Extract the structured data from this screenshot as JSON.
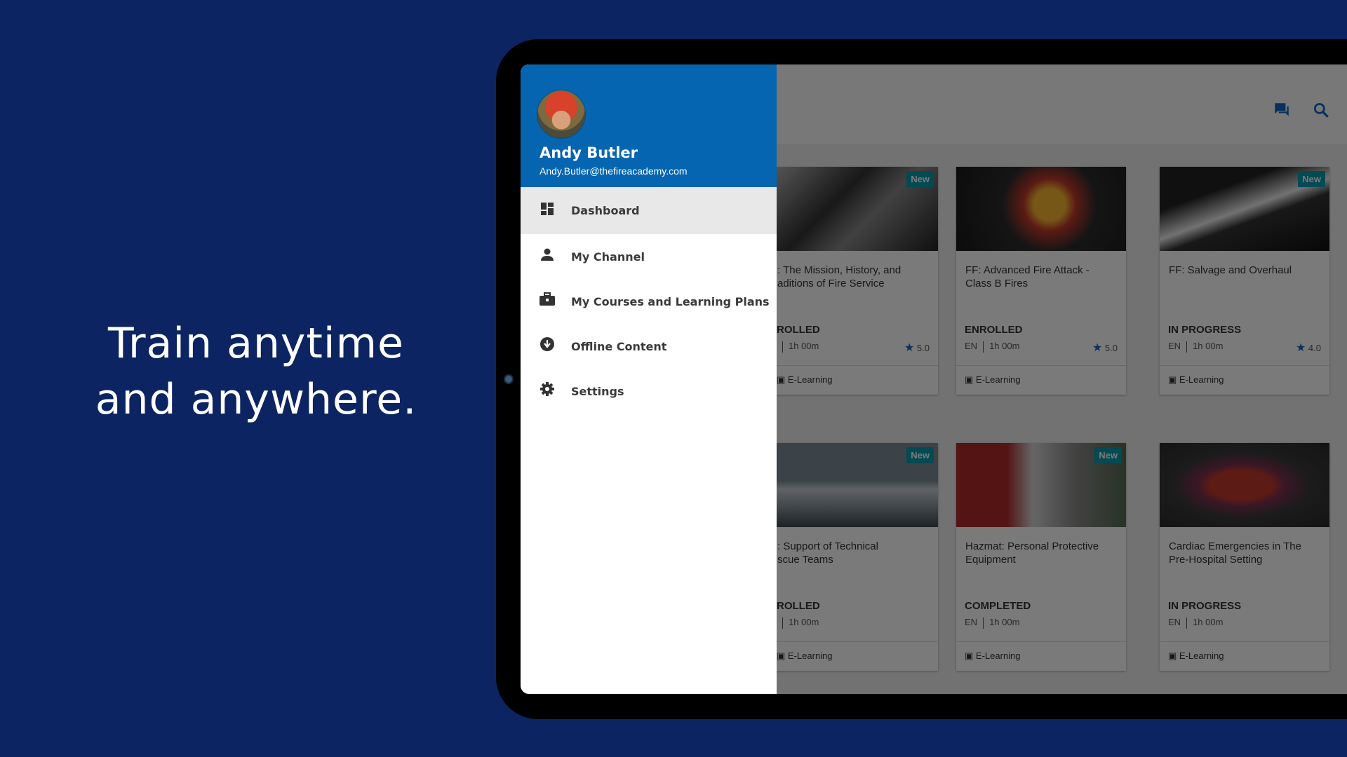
{
  "promo": {
    "line1": "Train anytime",
    "line2": "and anywhere."
  },
  "colors": {
    "background": "#0c2461",
    "drawer_header": "#0565b0",
    "accent": "#1565c0",
    "badge": "#0a9cad"
  },
  "topbar": {
    "icons": [
      "chat-icon",
      "search-icon"
    ]
  },
  "user": {
    "name": "Andy Butler",
    "email": "Andy.Butler@thefireacademy.com"
  },
  "menu": [
    {
      "label": "Dashboard",
      "icon": "dashboard-icon",
      "active": true
    },
    {
      "label": "My Channel",
      "icon": "person-icon"
    },
    {
      "label": "My Courses and Learning Plans",
      "icon": "briefcase-icon"
    },
    {
      "label": "Offline Content",
      "icon": "download-icon"
    },
    {
      "label": "Settings",
      "icon": "gear-icon"
    }
  ],
  "cards": [
    {
      "title": ": The Mission, History, and\naditions of Fire Service",
      "status": "ROLLED",
      "lang": "",
      "duration": "1h 00m",
      "rating": "5.0",
      "type": "E-Learning",
      "badge": "New"
    },
    {
      "title": "FF: Advanced Fire Attack - Class B Fires",
      "status": "ENROLLED",
      "lang": "EN",
      "duration": "1h 00m",
      "rating": "5.0",
      "type": "E-Learning",
      "badge": ""
    },
    {
      "title": "FF: Salvage and Overhaul",
      "status": "IN PROGRESS",
      "lang": "EN",
      "duration": "1h 00m",
      "rating": "4.0",
      "type": "E-Learning",
      "badge": "New"
    },
    {
      "title": ": Support of Technical\nscue Teams",
      "status": "ROLLED",
      "lang": "",
      "duration": "1h 00m",
      "rating": "",
      "type": "E-Learning",
      "badge": "New"
    },
    {
      "title": "Hazmat: Personal Protective Equipment",
      "status": "COMPLETED",
      "lang": "EN",
      "duration": "1h 00m",
      "rating": "",
      "type": "E-Learning",
      "badge": "New"
    },
    {
      "title": "Cardiac Emergencies in The Pre-Hospital Setting",
      "status": "IN PROGRESS",
      "lang": "EN",
      "duration": "1h 00m",
      "rating": "",
      "type": "E-Learning",
      "badge": ""
    }
  ]
}
